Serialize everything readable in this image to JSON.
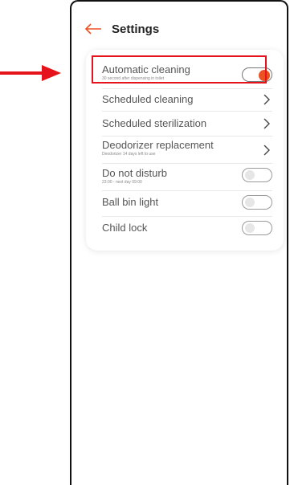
{
  "header": {
    "title": "Settings",
    "back_icon": "arrow-left-icon"
  },
  "settings": [
    {
      "label": "Automatic cleaning",
      "sublabel": "30 second after dispensing in toilet",
      "control": "toggle",
      "on": true
    },
    {
      "label": "Scheduled cleaning",
      "control": "chevron"
    },
    {
      "label": "Scheduled sterilization",
      "control": "chevron"
    },
    {
      "label": "Deodorizer replacement",
      "sublabel": "Deodorizer 14 days left to use",
      "control": "chevron"
    },
    {
      "label": "Do not disturb",
      "sublabel": "23:00 - next day 09:00",
      "control": "toggle",
      "on": false
    },
    {
      "label": "Ball bin light",
      "control": "toggle",
      "on": false
    },
    {
      "label": "Child lock",
      "control": "toggle",
      "on": false
    }
  ],
  "colors": {
    "accent": "#ec5221",
    "annotation": "#e5131c"
  }
}
